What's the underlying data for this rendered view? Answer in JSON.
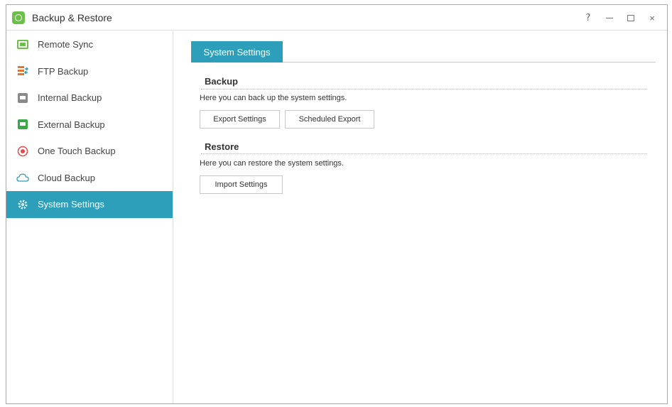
{
  "window": {
    "title": "Backup & Restore",
    "controls": {
      "help": "?",
      "minimize": "minimize",
      "maximize": "maximize",
      "close": "×"
    }
  },
  "sidebar": {
    "items": [
      {
        "label": "Remote Sync",
        "icon": "remote-sync-icon",
        "active": false
      },
      {
        "label": "FTP Backup",
        "icon": "ftp-backup-icon",
        "active": false
      },
      {
        "label": "Internal Backup",
        "icon": "internal-backup-icon",
        "active": false
      },
      {
        "label": "External Backup",
        "icon": "external-backup-icon",
        "active": false
      },
      {
        "label": "One Touch Backup",
        "icon": "one-touch-backup-icon",
        "active": false
      },
      {
        "label": "Cloud Backup",
        "icon": "cloud-backup-icon",
        "active": false
      },
      {
        "label": "System Settings",
        "icon": "system-settings-icon",
        "active": true
      }
    ]
  },
  "main": {
    "tab": "System Settings",
    "backup": {
      "title": "Backup",
      "description": "Here you can back up the system settings.",
      "export_button": "Export Settings",
      "scheduled_button": "Scheduled Export"
    },
    "restore": {
      "title": "Restore",
      "description": "Here you can restore the system settings.",
      "import_button": "Import Settings"
    }
  },
  "colors": {
    "accent": "#2e9fba",
    "app_icon": "#6cc04a"
  }
}
